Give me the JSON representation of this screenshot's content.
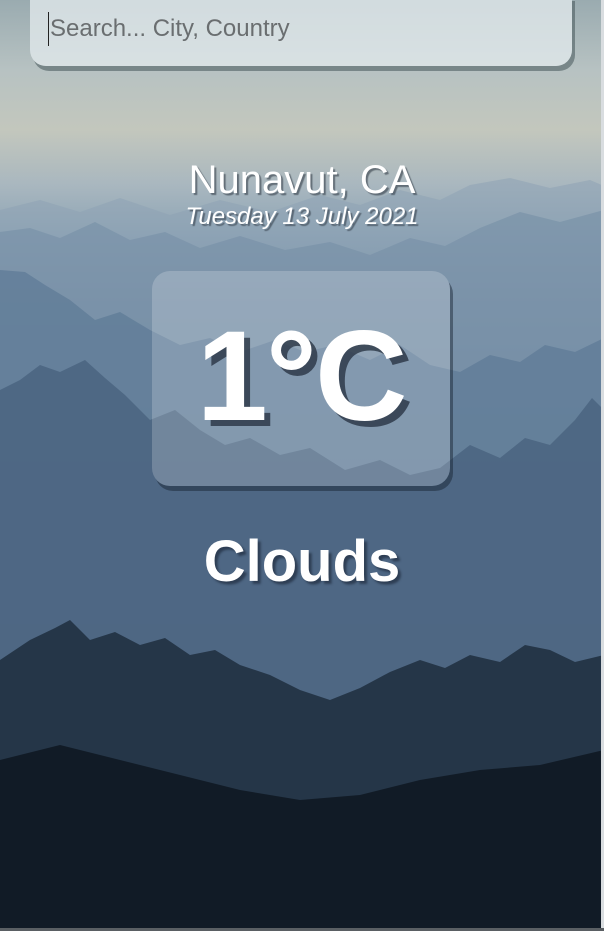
{
  "search": {
    "placeholder": "Search... City, Country",
    "value": ""
  },
  "location": {
    "name": "Nunavut, CA",
    "date": "Tuesday 13 July 2021"
  },
  "weather": {
    "temperature": "1°C",
    "condition": "Clouds"
  },
  "background": {
    "scene": "misty-mountains",
    "colors": {
      "sky_top": "#9aabb0",
      "haze": "#c3c7bd",
      "mid_ridge": "#5b7793",
      "dark_ridge": "#2b3e52",
      "base": "#0b121a"
    }
  }
}
